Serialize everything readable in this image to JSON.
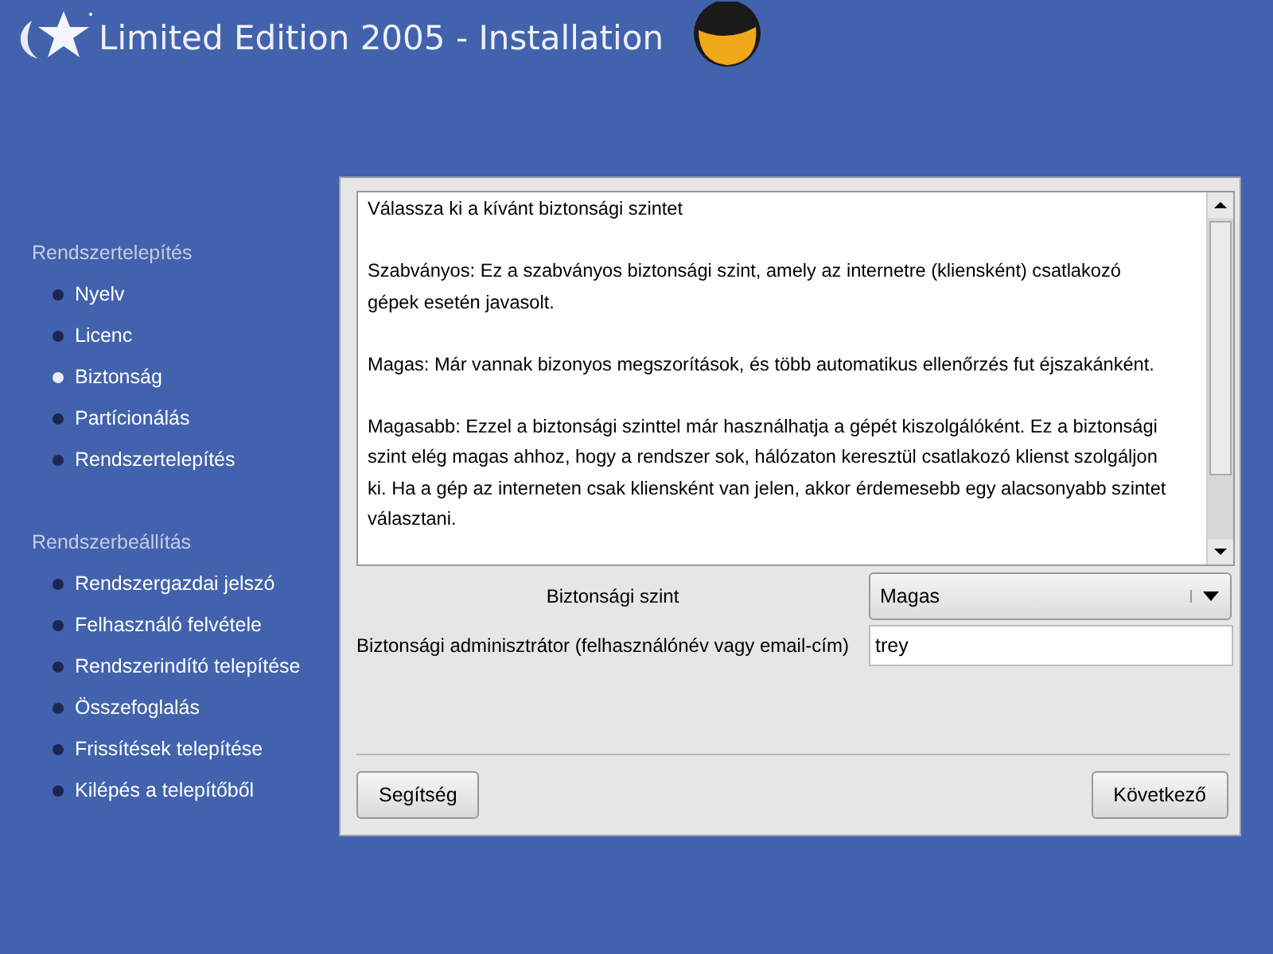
{
  "header": {
    "title": "Limited Edition 2005 - Installation"
  },
  "sidebar": {
    "sections": [
      {
        "title": "Rendszertelepítés",
        "items": [
          {
            "label": "Nyelv",
            "selected": false
          },
          {
            "label": "Licenc",
            "selected": false
          },
          {
            "label": "Biztonság",
            "selected": true
          },
          {
            "label": "Partícionálás",
            "selected": false
          },
          {
            "label": "Rendszertelepítés",
            "selected": false
          }
        ]
      },
      {
        "title": "Rendszerbeállítás",
        "items": [
          {
            "label": "Rendszergazdai jelszó",
            "selected": false
          },
          {
            "label": "Felhasználó felvétele",
            "selected": false
          },
          {
            "label": "Rendszerindító telepítése",
            "selected": false
          },
          {
            "label": "Összefoglalás",
            "selected": false
          },
          {
            "label": "Frissítések telepítése",
            "selected": false
          },
          {
            "label": "Kilépés a telepítőből",
            "selected": false
          }
        ]
      }
    ]
  },
  "description": [
    "Válassza ki a kívánt biztonsági szintet",
    "Szabványos: Ez a szabványos biztonsági szint, amely az internetre (kliensként) csatlakozó gépek esetén javasolt.",
    "Magas: Már vannak bizonyos megszorítások, és több automatikus ellenőrzés fut éjszakánként.",
    "Magasabb: Ezzel a biztonsági szinttel már használhatja a gépét kiszolgálóként. Ez a biztonsági szint elég magas ahhoz, hogy a rendszer sok, hálózaton keresztül csatlakozó klienst szolgáljon ki. Ha a gép az interneten csak kliensként van jelen, akkor érdemesebb egy alacsonyabb szintet választani."
  ],
  "security_level": {
    "label": "Biztonsági szint",
    "value": "Magas"
  },
  "security_admin": {
    "label": "Biztonsági adminisztrátor (felhasználónév vagy email-cím)",
    "value": "trey"
  },
  "buttons": {
    "help": "Segítség",
    "next": "Következő"
  }
}
